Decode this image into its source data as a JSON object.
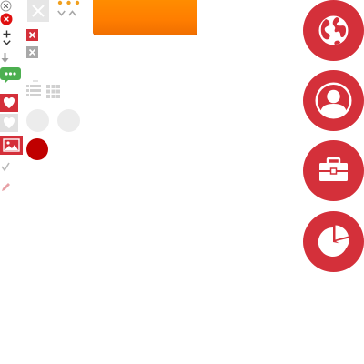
{
  "sprite_sheet": {
    "icons": [
      "close-circle-outline-icon",
      "close-circle-red-icon",
      "plus-icon",
      "chevron-down-icon",
      "arrow-down-icon",
      "chat-bubble-icon",
      "heart-red-icon",
      "heart-grey-icon",
      "image-icon",
      "checkmark-icon",
      "pencil-icon",
      "close-tile-icon",
      "close-small-red-icon",
      "close-small-grey-icon",
      "list-view-icon",
      "grid-view-icon",
      "dots-icon",
      "chevron-down-grey-icon",
      "chevron-up-grey-icon",
      "globe-icon",
      "user-profile-icon",
      "briefcase-icon",
      "pie-chart-icon"
    ],
    "colors": {
      "accent_red": "#d4303a",
      "dark_red": "#c00000",
      "orange": "#ff8c00",
      "green": "#4caf50",
      "grey_light": "#e6e6e6",
      "grey_mid": "#b0b0b0"
    }
  }
}
